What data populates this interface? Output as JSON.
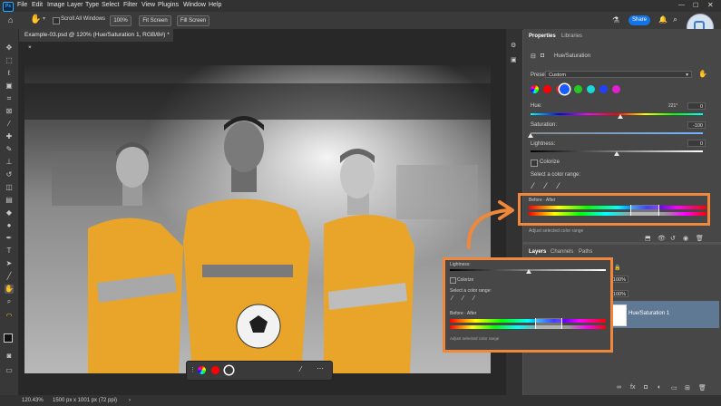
{
  "menubar": {
    "logo": "Ps",
    "items": [
      "File",
      "Edit",
      "Image",
      "Layer",
      "Type",
      "Select",
      "Filter",
      "View",
      "Plugins",
      "Window",
      "Help"
    ]
  },
  "options": {
    "scroll_all_label": "Scroll All Windows",
    "zoom_100": "100%",
    "fit_screen": "Fit Screen",
    "fill_screen": "Fill Screen",
    "share": "Share"
  },
  "document": {
    "tab_title": "Example-03.psd @ 120% (Hue/Saturation 1, RGB/8#) *",
    "close": "×"
  },
  "status": {
    "zoom": "120.43%",
    "size": "1500 px x 1001 px (72 ppi)"
  },
  "properties": {
    "tabs": [
      "Properties",
      "Libraries"
    ],
    "adjustment_title": "Hue/Saturation",
    "preset_label": "Preset:",
    "preset_value": "Custom",
    "hue_label": "Hue:",
    "hue_value": "0",
    "hue_pct": 0.52,
    "saturation_label": "Saturation:",
    "saturation_value": "-100",
    "saturation_pct": 0.0,
    "lightness_label": "Lightness:",
    "lightness_value": "0",
    "lightness_pct": 0.5,
    "colorize_label": "Colorize",
    "select_range_label": "Select a color range:",
    "before_after_label": "Before · After",
    "adjust_range_label": "Adjust selected color range"
  },
  "swatches": [
    "#ff0000",
    "#e02020",
    "#1a5cff",
    "#22cc22",
    "#18d8d8",
    "#2040ff",
    "#e020d0"
  ],
  "layers": {
    "tabs": [
      "Layers",
      "Channels",
      "Paths"
    ],
    "opacity": "100%",
    "fill": "100%",
    "layer_name": "Hue/Saturation 1"
  },
  "zoom_popup": {
    "lightness_label": "Lightness:",
    "colorize_label": "Colorize",
    "select_range_label": "Select a color range:",
    "before_after_label": "Before · After",
    "adjust_range_label": "Adjust selected color range"
  },
  "colors": {
    "accent": "#f0873a",
    "jersey": "#e8a52a",
    "brand_blue": "#1473e6"
  }
}
